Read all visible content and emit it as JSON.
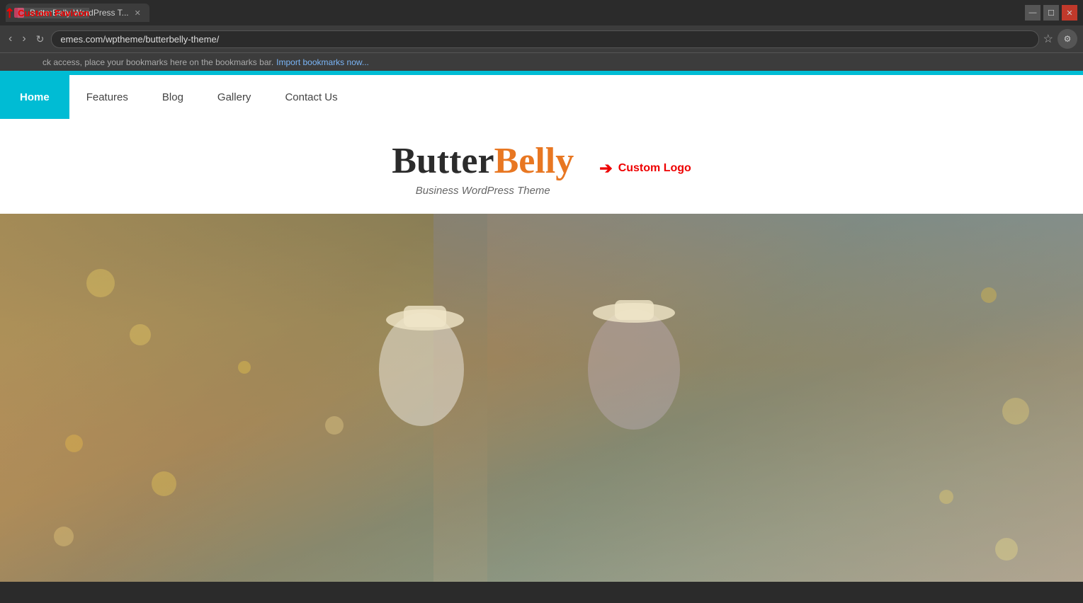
{
  "browser": {
    "tab_title": "ButterBelly WordPress T...",
    "address": "emes.com/wptheme/butterbelly-theme/",
    "bookmarks_text": "ck access, place your bookmarks here on the bookmarks bar.",
    "bookmarks_link": "Import bookmarks now..."
  },
  "annotations": {
    "custom_favicon": "Custom Favicon",
    "custom_logo": "Custom Logo"
  },
  "nav": {
    "home": "Home",
    "features": "Features",
    "blog": "Blog",
    "gallery": "Gallery",
    "contact_us": "Contact Us"
  },
  "logo": {
    "butter": "Butter",
    "belly": "Belly",
    "tagline": "Business WordPress Theme"
  },
  "colors": {
    "teal": "#00bcd4",
    "nav_home_bg": "#00bcd4",
    "logo_belly": "#e87722",
    "annotation_red": "#cc0000"
  }
}
